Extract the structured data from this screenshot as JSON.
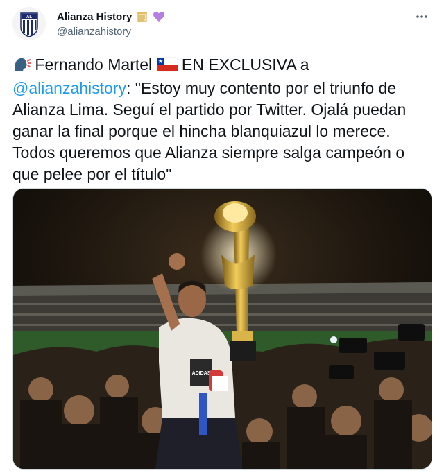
{
  "author": {
    "display_name": "Alianza History",
    "handle": "@alianzahistory",
    "name_emojis": [
      "scroll-emoji",
      "purple-heart-emoji"
    ]
  },
  "tweet": {
    "text_part1": " Fernando Martel ",
    "text_part2": " EN EXCLUSIVA a",
    "mention": "@alianzahistory",
    "text_part3": ": \"Estoy muy contento por el triunfo de Alianza Lima. Seguí el partido por Twitter. Ojalá puedan ganar la final porque el hincha blanquiazul lo merece. Todos queremos que Alianza siempre salga campeón o que pelee por el título\"",
    "leading_icon": "speaking-head-icon",
    "flag_icon": "chile-flag-icon"
  },
  "media": {
    "icon": "trophy-celebration-photo",
    "badge_text": "ADIDAS"
  },
  "colors": {
    "accent": "#1d9bf0",
    "text": "#0f1419",
    "secondary": "#536471",
    "heart": "#b37fe0"
  },
  "menu": {
    "icon": "more-options-icon"
  }
}
